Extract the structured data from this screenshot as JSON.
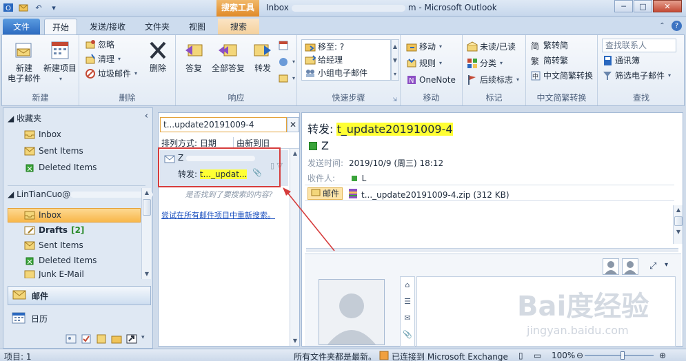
{
  "titlebar": {
    "context_tab": "搜索工具",
    "title_prefix": "Inbox",
    "title_suffix": "m - Microsoft Outlook",
    "minimize": "─",
    "maximize": "□",
    "close": "✕"
  },
  "tabs": {
    "file": "文件",
    "home": "开始",
    "send_receive": "发送/接收",
    "folder": "文件夹",
    "view": "视图",
    "search": "搜索"
  },
  "ribbon": {
    "new": {
      "label": "新建",
      "new_email": "新建\n电子邮件",
      "new_items": "新建项目"
    },
    "delete": {
      "label": "删除",
      "ignore": "忽略",
      "clean_up": "清理",
      "junk": "垃圾邮件",
      "delete": "删除"
    },
    "respond": {
      "label": "响应",
      "reply": "答复",
      "reply_all": "全部答复",
      "forward": "转发"
    },
    "quick_steps": {
      "label": "快速步骤",
      "move_to": "移至: ?",
      "to_manager": "给经理",
      "team_email": "小组电子邮件"
    },
    "move": {
      "label": "移动",
      "move": "移动",
      "rules": "规则",
      "onenote": "OneNote"
    },
    "tags": {
      "label": "标记",
      "unread_read": "未读/已读",
      "categorize": "分类",
      "follow_up": "后续标志"
    },
    "chinese_conv": {
      "label": "中文简繁转换",
      "trad_to_simp": "繁转简",
      "simp_to_trad": "简转繁",
      "conversion": "中文简繁转换"
    },
    "find": {
      "label": "查找",
      "search_people": "查找联系人",
      "address_book": "通讯簿",
      "filter_email": "筛选电子邮件"
    }
  },
  "nav": {
    "favorites": "收藏夹",
    "fav_inbox": "Inbox",
    "fav_sent": "Sent Items",
    "fav_deleted": "Deleted Items",
    "account_prefix": "LinTianCuo@",
    "inbox": "Inbox",
    "drafts": "Drafts",
    "drafts_count": "[2]",
    "sent": "Sent Items",
    "deleted": "Deleted Items",
    "junk": "Junk E-Mail",
    "mail": "邮件",
    "calendar": "日历"
  },
  "list": {
    "search_text": "t...update20191009-4",
    "clear": "✕",
    "sort_by": "排列方式: 日期",
    "sort_order": "由新到旧",
    "item_sender": "Z",
    "item_subject_prefix": "转发: ",
    "item_subject_hl": "t..._updat...",
    "no_results_hint": "是否找到了要搜索的内容?",
    "retry_search": "尝试在所有邮件项目中重新搜索。"
  },
  "reading": {
    "subject_prefix": "转发: ",
    "subject_hl": "t_update20191009-4",
    "from": "Z",
    "sent_label": "发送时间:",
    "sent_value": "2019/10/9 (周三) 18:12",
    "to_label": "收件人:",
    "to_value": "L",
    "mail_tab": "邮件",
    "attachment": "t..._update20191009-4.zip (312 KB)"
  },
  "status": {
    "items": "项目: 1",
    "updated": "所有文件夹都是最新。",
    "connected": "已连接到 Microsoft Exchange",
    "zoom": "100%"
  },
  "watermark": {
    "brand": "Bai度经验",
    "url": "jingyan.baidu.com"
  },
  "colors": {
    "accent": "#2a68bf",
    "selection": "#f8b74a",
    "highlight": "#ffff33",
    "annotation": "#d63c3c"
  }
}
